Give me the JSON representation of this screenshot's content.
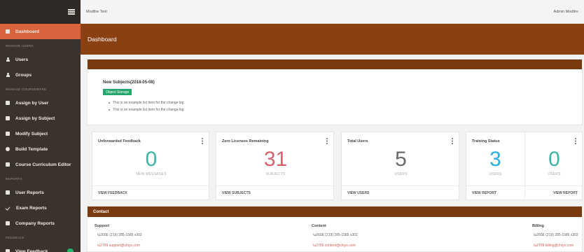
{
  "sidebar": {
    "items": [
      {
        "type": "item",
        "label": "Dashboard",
        "icon": "grid-icon",
        "active": true
      },
      {
        "type": "section",
        "label": "MANAGE USERS"
      },
      {
        "type": "item",
        "label": "Users",
        "icon": "user-icon"
      },
      {
        "type": "item",
        "label": "Groups",
        "icon": "users-icon"
      },
      {
        "type": "section",
        "label": "MANAGE COURSEWARE"
      },
      {
        "type": "item",
        "label": "Assign by User",
        "icon": "assign-user-icon"
      },
      {
        "type": "item",
        "label": "Assign by Subject",
        "icon": "assign-subject-icon"
      },
      {
        "type": "item",
        "label": "Modify Subject",
        "icon": "edit-icon"
      },
      {
        "type": "item",
        "label": "Build Template",
        "icon": "wrench-icon"
      },
      {
        "type": "item",
        "label": "Course Curriculum Editor",
        "icon": "editor-icon"
      },
      {
        "type": "section",
        "label": "REPORTS"
      },
      {
        "type": "item",
        "label": "User Reports",
        "icon": "report-icon"
      },
      {
        "type": "item",
        "label": "Exam Reports",
        "icon": "check-icon"
      },
      {
        "type": "item",
        "label": "Company Reports",
        "icon": "building-icon"
      },
      {
        "type": "section",
        "label": "FEEDBACK"
      },
      {
        "type": "item",
        "label": "View Feedback",
        "icon": "feedback-icon",
        "badge": true
      }
    ]
  },
  "topbar": {
    "app_title": "Modfire Test",
    "user_label": "Admin Modfire"
  },
  "header": {
    "title": "Dashboard"
  },
  "changelog": {
    "version": "New Subjects(2018-05-08)",
    "tag": "Object Storage",
    "items": [
      "This is an example list item for the change log",
      "This is an example list item for the change log"
    ]
  },
  "cards": {
    "feedback": {
      "title": "Unforwarded Feedback",
      "value": "0",
      "unit": "NEW MESSAGES",
      "link": "VIEW FEEDBACK",
      "color": "#3bb5a5"
    },
    "licenses": {
      "title": "Zero Licenses Remaining",
      "value": "31",
      "unit": "SUBJECTS",
      "link": "VIEW SUBJECTS",
      "color": "#d9606c"
    },
    "users": {
      "title": "Total Users",
      "value": "5",
      "unit": "USERS",
      "link": "VIEW USERS",
      "color": "#6a6a6a"
    },
    "training": {
      "title": "Training Status",
      "left": {
        "value": "3",
        "unit": "USERS",
        "link": "VIEW REPORT",
        "color": "#2aaee0"
      },
      "right": {
        "value": "0",
        "unit": "USERS",
        "link": "VIEW REPORT",
        "color": "#3bb5a5"
      }
    }
  },
  "contact": {
    "title": "Contact",
    "support": {
      "label": "Support",
      "phone": "(219) 285-1585 x302",
      "email": "support@chiyo.com"
    },
    "content": {
      "label": "Content",
      "phone": "(219) 285-1585 x303",
      "email": "content@chiyo.com"
    },
    "billing": {
      "label": "Billing",
      "phone": "(219) 285-1585 x302",
      "email": "billing@chiyo.com"
    }
  }
}
